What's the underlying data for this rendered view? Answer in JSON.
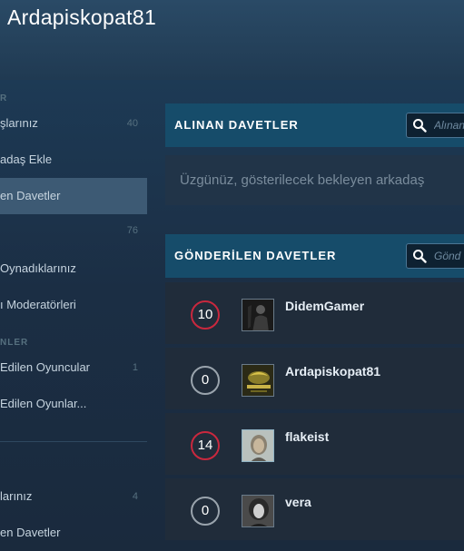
{
  "header": {
    "title": "Ardapiskopat81"
  },
  "sidebar": {
    "headings": [
      "R",
      "NLER"
    ],
    "items": [
      {
        "label": "şlarınız",
        "count": "40"
      },
      {
        "label": "adaş Ekle",
        "count": ""
      },
      {
        "label": "en Davetler",
        "count": ""
      },
      {
        "label": "",
        "count": "76"
      },
      {
        "label": "Oynadıklarınız",
        "count": ""
      },
      {
        "label": "ı Moderatörleri",
        "count": ""
      },
      {
        "label": "Edilen Oyuncular",
        "count": "1"
      },
      {
        "label": "Edilen Oyunlar...",
        "count": ""
      },
      {
        "label": "larınız",
        "count": "4"
      },
      {
        "label": "en Davetler",
        "count": ""
      }
    ]
  },
  "received": {
    "title": "ALINAN DAVETLER",
    "search_placeholder": "Alınan",
    "empty_message": "Üzgünüz, gösterilecek bekleyen arkadaş"
  },
  "sent": {
    "title": "GÖNDERİLEN DAVETLER",
    "search_placeholder": "Gönd",
    "friends": [
      {
        "level": "10",
        "name": "DidemGamer",
        "avatar": "dark-figure"
      },
      {
        "level": "0",
        "name": "Ardapiskopat81",
        "avatar": "game-logo"
      },
      {
        "level": "14",
        "name": "flakeist",
        "avatar": "portrait"
      },
      {
        "level": "0",
        "name": "vera",
        "avatar": "bw-portrait"
      }
    ]
  },
  "colors": {
    "panel_header": "#164c6a",
    "active_sidebar": "#3d5a74",
    "badge_red": "#c9283e",
    "badge_gray": "#9aa4ad"
  }
}
